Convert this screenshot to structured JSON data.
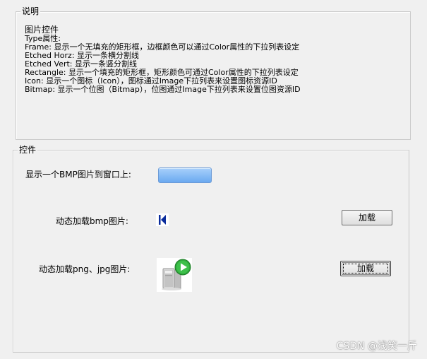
{
  "description_group": {
    "title": "说明",
    "heading": "图片控件",
    "lines": [
      "Type属性:",
      "Frame: 显示一个无填充的矩形框，边框颜色可以通过Color属性的下拉列表设定",
      "Etched Horz: 显示一条横分割线",
      "Etched Vert: 显示一条竖分割线",
      "Rectangle: 显示一个填充的矩形框，矩形颜色可通过Color属性的下拉列表设定",
      "Icon: 显示一个图标（Icon），图标通过Image下拉列表来设置图标资源ID",
      "Bitmap: 显示一个位图（Bitmap），位图通过Image下拉列表来设置位图资源ID"
    ]
  },
  "control_group": {
    "title": "控件",
    "bmp_label": "显示一个BMP图片到窗口上:",
    "dynamic_bmp_label": "动态加载bmp图片:",
    "dynamic_bmp_button": "加载",
    "dynamic_png_label": "动态加载png、jpg图片:",
    "dynamic_png_button": "加载"
  },
  "watermark": "CSDN @浅笑一斤",
  "icons": {
    "bmp_icon": "skip-back-icon",
    "png_picture": "computer-play-icon"
  },
  "colors": {
    "bitmap_fill_top": "#a8d0fb",
    "bitmap_fill_bottom": "#6aa9f0",
    "icon_blue": "#0a2c9c",
    "play_green": "#2ea83a"
  }
}
